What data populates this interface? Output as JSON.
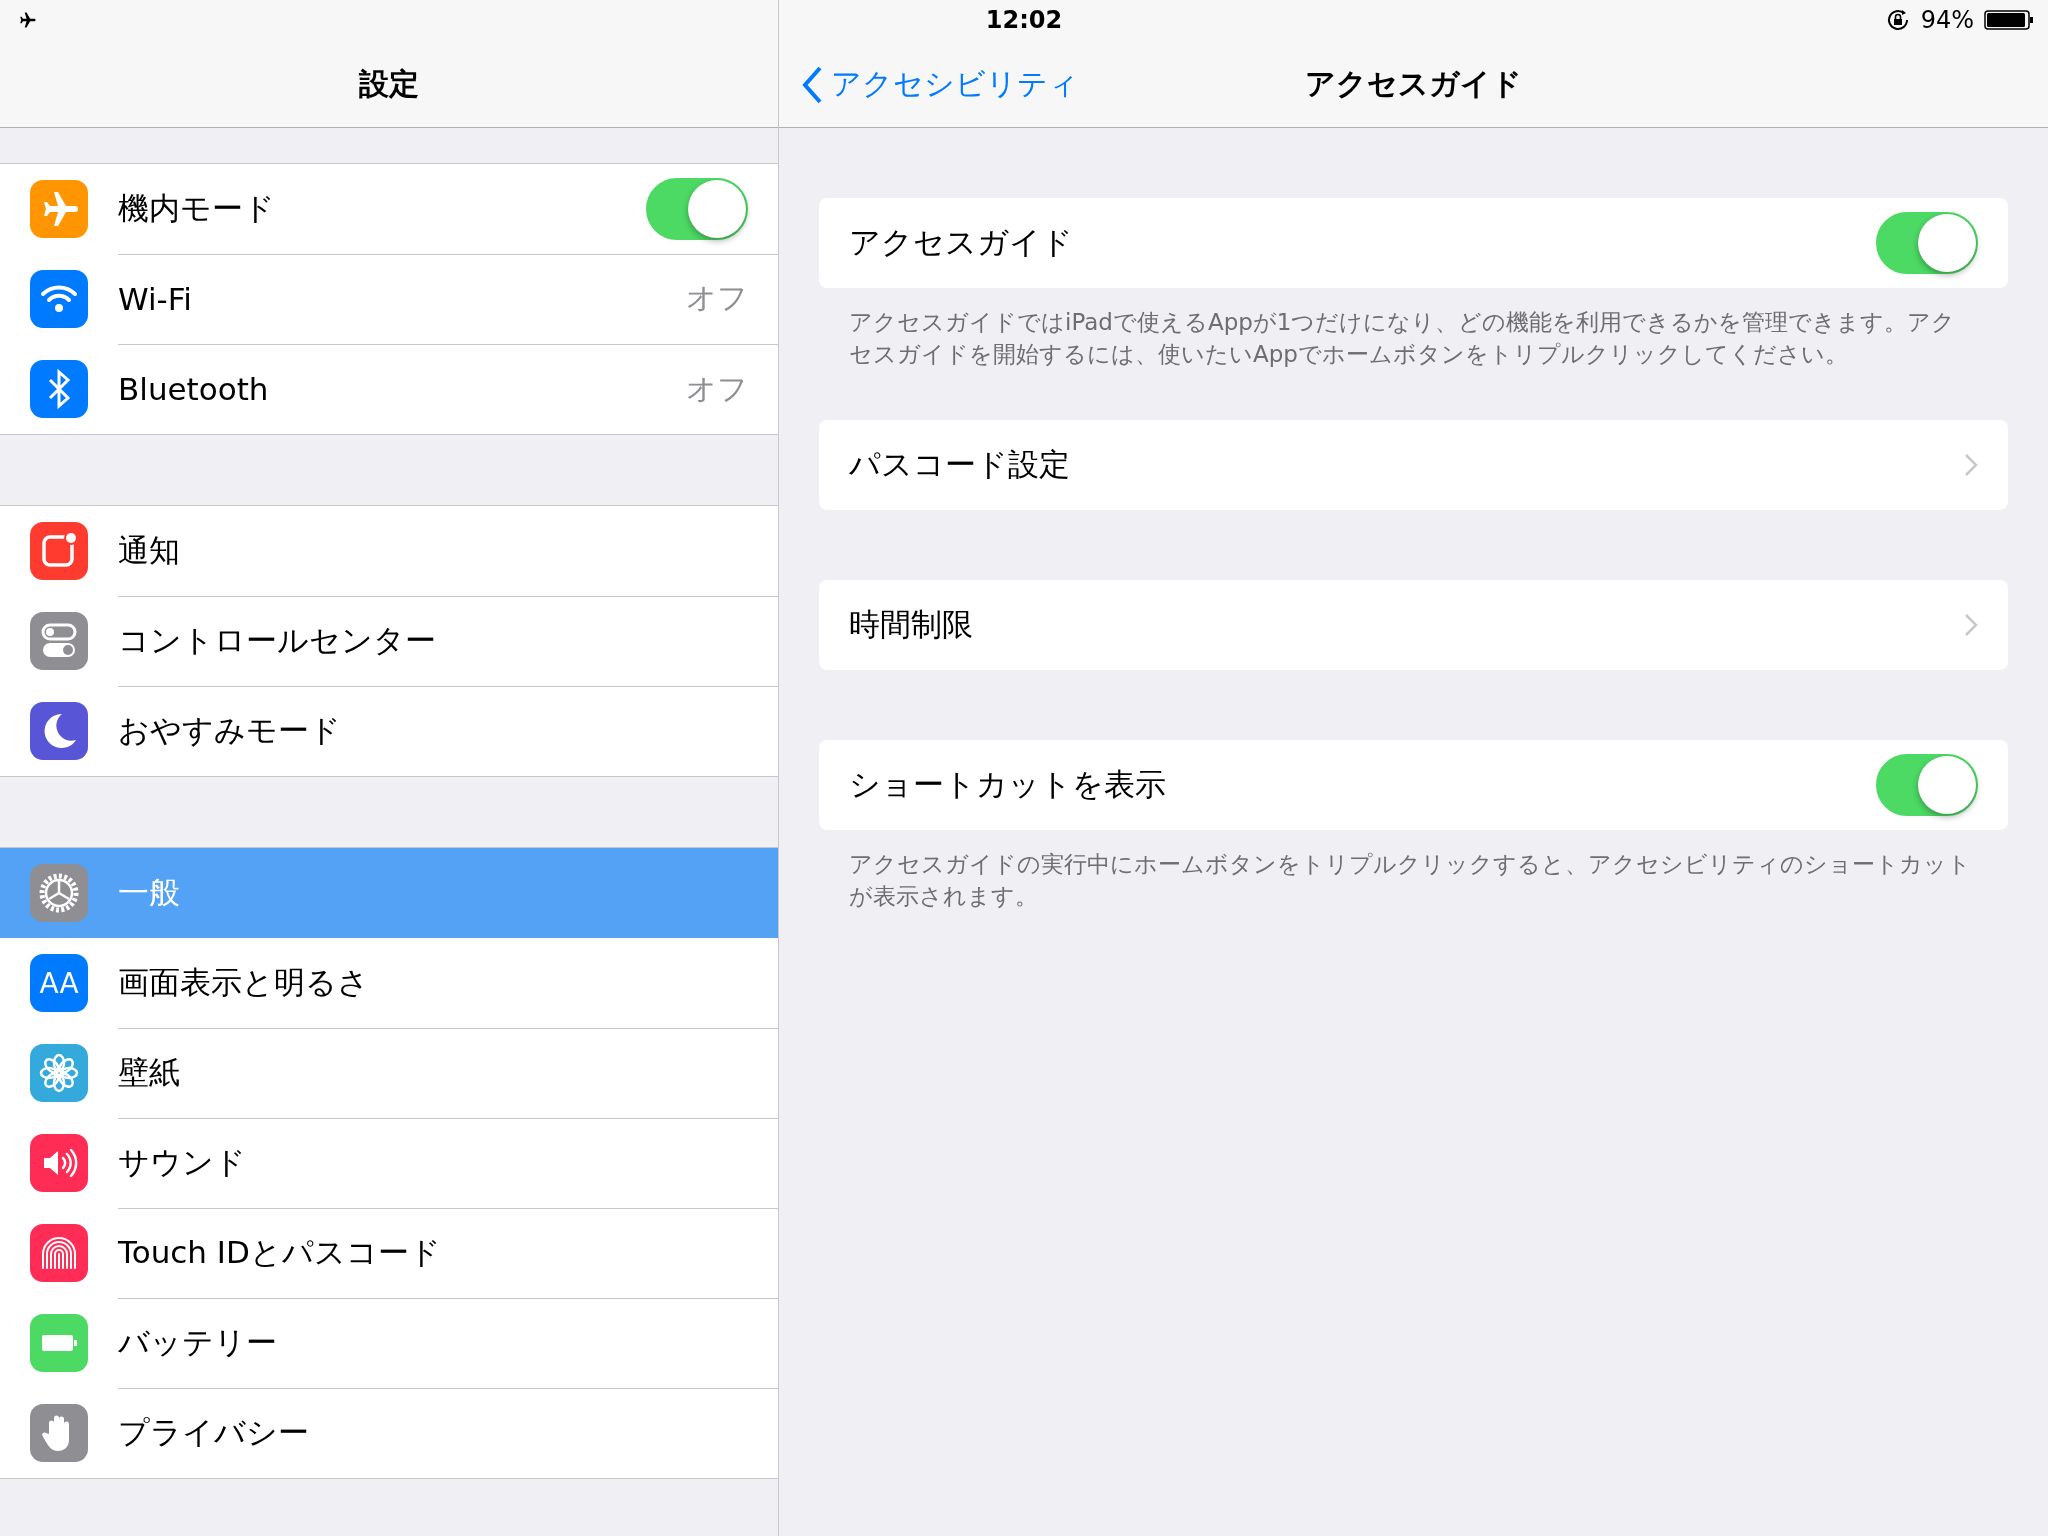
{
  "status_bar": {
    "time": "12:02",
    "battery_text": "94%"
  },
  "sidebar": {
    "title": "設定",
    "groups": [
      [
        {
          "label": "機内モード",
          "kind": "toggle",
          "on": true,
          "selected": false
        },
        {
          "label": "Wi-Fi",
          "kind": "value",
          "value": "オフ",
          "selected": false
        },
        {
          "label": "Bluetooth",
          "kind": "value",
          "value": "オフ",
          "selected": false
        }
      ],
      [
        {
          "label": "通知",
          "kind": "plain",
          "selected": false
        },
        {
          "label": "コントロールセンター",
          "kind": "plain",
          "selected": false
        },
        {
          "label": "おやすみモード",
          "kind": "plain",
          "selected": false
        }
      ],
      [
        {
          "label": "一般",
          "kind": "plain",
          "selected": true
        },
        {
          "label": "画面表示と明るさ",
          "icon_text": "AA",
          "kind": "plain",
          "selected": false
        },
        {
          "label": "壁紙",
          "kind": "plain",
          "selected": false
        },
        {
          "label": "サウンド",
          "kind": "plain",
          "selected": false
        },
        {
          "label": "Touch IDとパスコード",
          "kind": "plain",
          "selected": false
        },
        {
          "label": "バッテリー",
          "kind": "plain",
          "selected": false
        },
        {
          "label": "プライバシー",
          "kind": "plain",
          "selected": false
        }
      ]
    ]
  },
  "nav": {
    "back_label": "アクセシビリティ",
    "title": "アクセスガイド"
  },
  "sections": [
    {
      "kind": "toggle",
      "label": "アクセスガイド",
      "on": true,
      "footer": "アクセスガイドではiPadで使えるAppが1つだけになり、どの機能を利用できるかを管理できます。アクセスガイドを開始するには、使いたいAppでホームボタンをトリプルクリックしてください。"
    },
    {
      "kind": "link",
      "label": "パスコード設定"
    },
    {
      "kind": "link",
      "label": "時間制限"
    },
    {
      "kind": "toggle",
      "label": "ショートカットを表示",
      "on": true,
      "footer": "アクセスガイドの実行中にホームボタンをトリプルクリックすると、アクセシビリティのショートカットが表示されます。"
    }
  ]
}
